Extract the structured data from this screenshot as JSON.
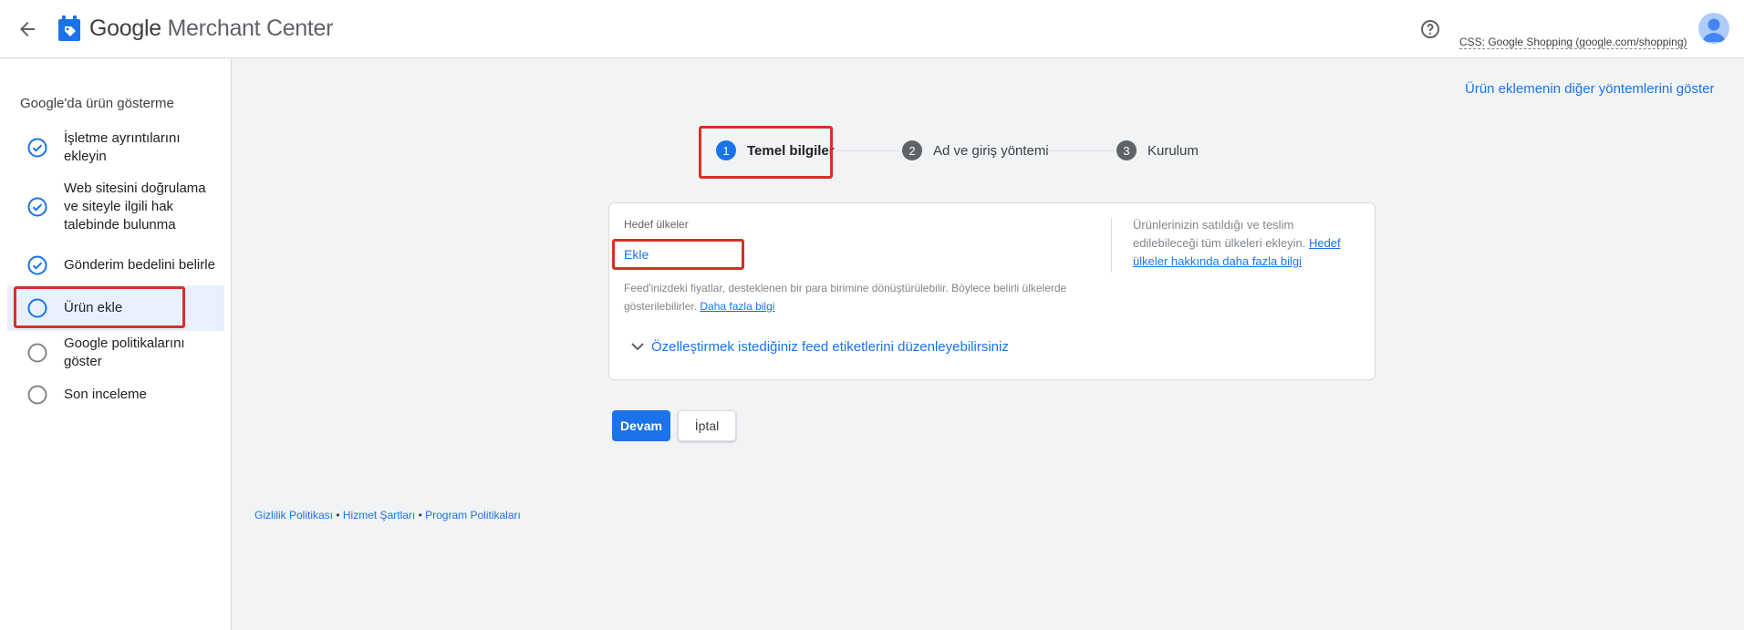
{
  "header": {
    "brand_google": "Google",
    "brand_product": "Merchant Center",
    "account": "CSS: Google Shopping (google.com/shopping)"
  },
  "sidebar": {
    "title": "Google'da ürün gösterme",
    "steps": [
      {
        "label": "İşletme ayrıntılarını ekleyin",
        "status": "done"
      },
      {
        "label": "Web sitesini doğrulama ve siteyle ilgili hak talebinde bulunma",
        "status": "done"
      },
      {
        "label": "Gönderim bedelini belirle",
        "status": "done"
      },
      {
        "label": "Ürün ekle",
        "status": "current"
      },
      {
        "label": "Google politikalarını göster",
        "status": "pending"
      },
      {
        "label": "Son inceleme",
        "status": "pending"
      }
    ]
  },
  "main": {
    "other_methods_link": "Ürün eklemenin diğer yöntemlerini göster",
    "stepper": [
      {
        "num": "1",
        "label": "Temel bilgiler"
      },
      {
        "num": "2",
        "label": "Ad ve giriş yöntemi"
      },
      {
        "num": "3",
        "label": "Kurulum"
      }
    ],
    "card": {
      "field_label": "Hedef ülkeler",
      "add_link": "Ekle",
      "feed_note": "Feed'inizdeki fiyatlar, desteklenen bir para birimine dönüştürülebilir. Böylece belirli ülkelerde gösterilebilirler.",
      "feed_note_link": "Daha fazla bilgi",
      "side_note": "Ürünlerinizin satıldığı ve teslim edilebileceği tüm ülkeleri ekleyin.",
      "side_note_link": "Hedef ülkeler hakkında daha fazla bilgi",
      "expand_label": "Özelleştirmek istediğiniz feed etiketlerini düzenleyebilirsiniz"
    },
    "buttons": {
      "continue": "Devam",
      "cancel": "İptal"
    }
  },
  "footer": {
    "privacy": "Gizlilik Politikası",
    "terms": "Hizmet Şartları",
    "program": "Program Politikaları",
    "separator": " • "
  },
  "colors": {
    "accent": "#1a73e8",
    "highlight_box": "#d93025",
    "active_row": "#e8f0fe"
  }
}
